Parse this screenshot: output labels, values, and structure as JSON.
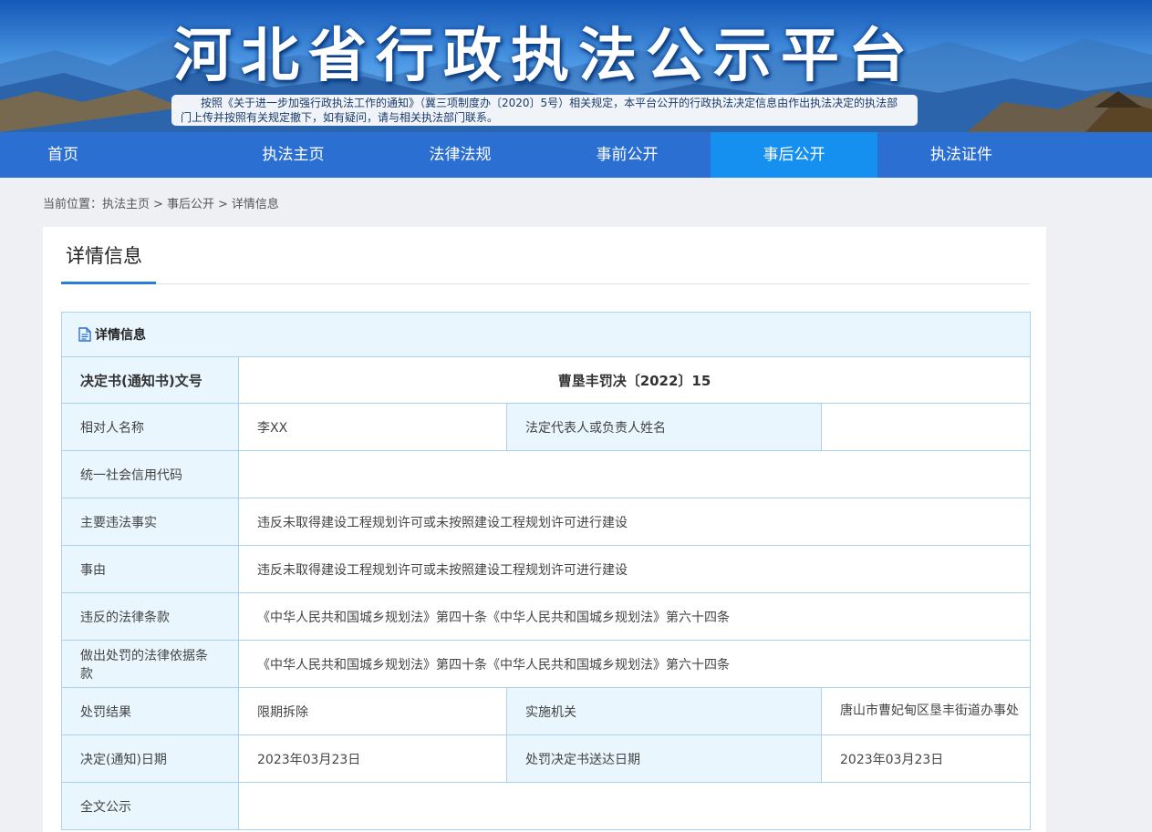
{
  "banner": {
    "title": "河北省行政执法公示平台",
    "notice": "按照《关于进一步加强行政执法工作的通知》（冀三项制度办〔2020〕5号）相关规定，本平台公开的行政执法决定信息由作出执法决定的执法部门上传并按照有关规定撤下，如有疑问，请与相关执法部门联系。"
  },
  "nav": {
    "items": [
      "首页",
      "执法主页",
      "法律法规",
      "事前公开",
      "事后公开",
      "执法证件"
    ],
    "active_index": 4
  },
  "breadcrumb": {
    "prefix": "当前位置：",
    "items": [
      "执法主页",
      "事后公开",
      "详情信息"
    ],
    "separator": ">"
  },
  "page": {
    "title": "详情信息"
  },
  "detail": {
    "section_title": "详情信息",
    "doc_number_label": "决定书(通知书)文号",
    "doc_number": "曹垦丰罚决〔2022〕15",
    "party_name_label": "相对人名称",
    "party_name": "李XX",
    "legal_rep_label": "法定代表人或负责人姓名",
    "legal_rep": "",
    "credit_code_label": "统一社会信用代码",
    "credit_code": "",
    "main_facts_label": "主要违法事实",
    "main_facts": "违反未取得建设工程规划许可或未按照建设工程规划许可进行建设",
    "reason_label": "事由",
    "reason": "违反未取得建设工程规划许可或未按照建设工程规划许可进行建设",
    "violated_law_label": "违反的法律条款",
    "violated_law": "《中华人民共和国城乡规划法》第四十条《中华人民共和国城乡规划法》第六十四条",
    "penalty_basis_label": "做出处罚的法律依据条款",
    "penalty_basis": "《中华人民共和国城乡规划法》第四十条《中华人民共和国城乡规划法》第六十四条",
    "result_label": "处罚结果",
    "result": "限期拆除",
    "agency_label": "实施机关",
    "agency": "唐山市曹妃甸区垦丰街道办事处",
    "decision_date_label": "决定(通知)日期",
    "decision_date": "2023年03月23日",
    "delivery_date_label": "处罚决定书送达日期",
    "delivery_date": "2023年03月23日",
    "full_text_label": "全文公示",
    "full_text": ""
  },
  "colors": {
    "nav_bg": "#2b6fd3",
    "nav_active": "#1690f0",
    "label_bg": "#e9f6fd",
    "border": "#a9d2ec",
    "accent": "#2b7bd8"
  }
}
